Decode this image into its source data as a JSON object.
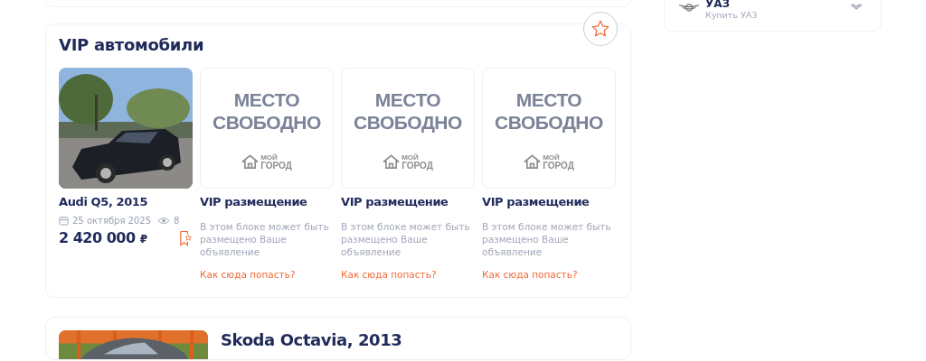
{
  "sidebar": {
    "brand": {
      "name": "УАЗ",
      "subtitle": "Купить УАЗ"
    }
  },
  "vip_block": {
    "title": "VIP автомобили",
    "items": [
      {
        "kind": "car",
        "title": "Audi Q5, 2015",
        "date": "25 октября 2025",
        "views": "8",
        "price": "2 420 000",
        "currency": "₽"
      },
      {
        "kind": "placeholder",
        "banner": [
          "МЕСТО",
          "СВОБОДНО"
        ],
        "logo": [
          "МОЙ",
          "ГОРОД"
        ],
        "title": "VIP размещение",
        "description": "В этом блоке может быть размещено Ваше объявление",
        "link": "Как сюда попасть?"
      },
      {
        "kind": "placeholder",
        "banner": [
          "МЕСТО",
          "СВОБОДНО"
        ],
        "logo": [
          "МОЙ",
          "ГОРОД"
        ],
        "title": "VIP размещение",
        "description": "В этом блоке может быть размещено Ваше объявление",
        "link": "Как сюда попасть?"
      },
      {
        "kind": "placeholder",
        "banner": [
          "МЕСТО",
          "СВОБОДНО"
        ],
        "logo": [
          "МОЙ",
          "ГОРОД"
        ],
        "title": "VIP размещение",
        "description": "В этом блоке может быть размещено Ваше объявление",
        "link": "Как сюда попасть?"
      }
    ]
  },
  "listing": {
    "title": "Skoda Octavia, 2013"
  }
}
